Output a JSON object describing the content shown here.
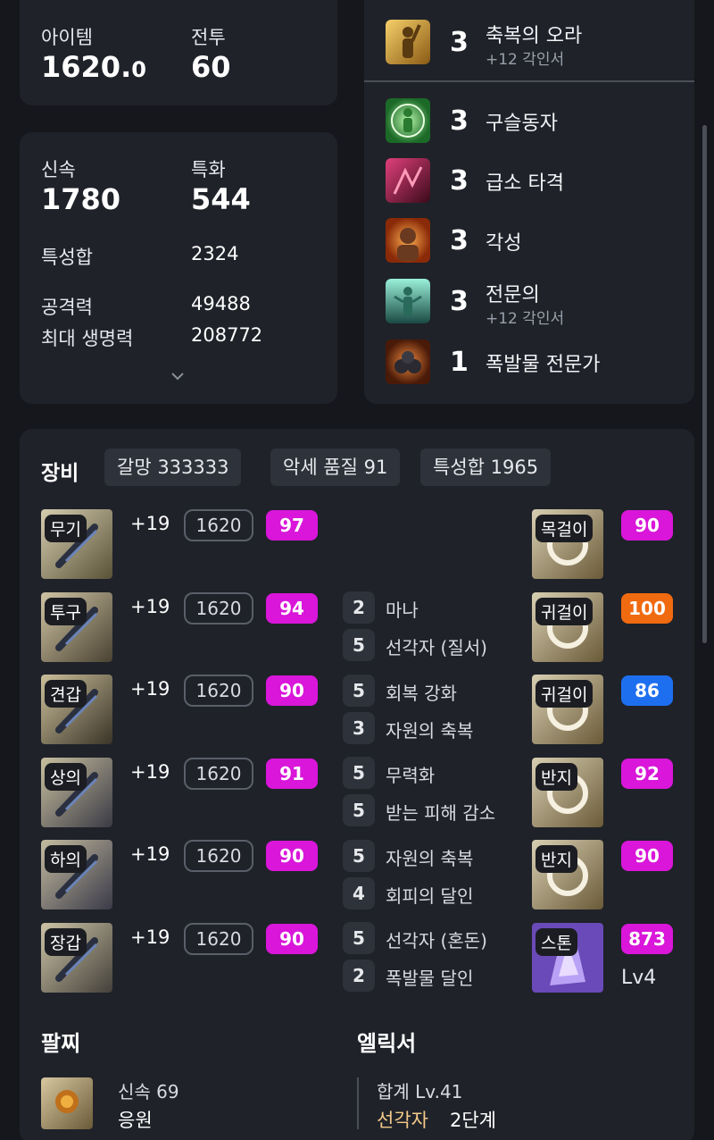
{
  "summary": {
    "item_level_label": "아이템",
    "item_level_int": "1620.",
    "item_level_dec": "0",
    "combat_label": "전투",
    "combat_value": "60"
  },
  "stats": {
    "swift_label": "신속",
    "swift_value": "1780",
    "spec_label": "특화",
    "spec_value": "544",
    "sum_label": "특성합",
    "sum_value": "2324",
    "atk_label": "공격력",
    "atk_value": "49488",
    "hp_label": "최대 생명력",
    "hp_value": "208772"
  },
  "engravings": [
    {
      "level": "3",
      "name": "축복의 오라",
      "sub": "+12 각인서"
    },
    {
      "level": "3",
      "name": "구슬동자",
      "sub": ""
    },
    {
      "level": "3",
      "name": "급소 타격",
      "sub": ""
    },
    {
      "level": "3",
      "name": "각성",
      "sub": ""
    },
    {
      "level": "3",
      "name": "전문의",
      "sub": "+12 각인서"
    },
    {
      "level": "1",
      "name": "폭발물 전문가",
      "sub": ""
    }
  ],
  "equipment": {
    "title": "장비",
    "chips": [
      "갈망 333333",
      "악세 품질 91",
      "특성합 1965"
    ],
    "armor": [
      {
        "slot": "무기",
        "hone": "+19",
        "ilvl": "1620",
        "quality": "97"
      },
      {
        "slot": "투구",
        "hone": "+19",
        "ilvl": "1620",
        "quality": "94"
      },
      {
        "slot": "견갑",
        "hone": "+19",
        "ilvl": "1620",
        "quality": "90"
      },
      {
        "slot": "상의",
        "hone": "+19",
        "ilvl": "1620",
        "quality": "91"
      },
      {
        "slot": "하의",
        "hone": "+19",
        "ilvl": "1620",
        "quality": "90"
      },
      {
        "slot": "장갑",
        "hone": "+19",
        "ilvl": "1620",
        "quality": "90"
      }
    ],
    "accessory_engr": [
      {
        "num": "2",
        "name": "마나"
      },
      {
        "num": "5",
        "name": "선각자 (질서)"
      },
      {
        "num": "5",
        "name": "회복 강화"
      },
      {
        "num": "3",
        "name": "자원의 축복"
      },
      {
        "num": "5",
        "name": "무력화"
      },
      {
        "num": "5",
        "name": "받는 피해 감소"
      },
      {
        "num": "5",
        "name": "자원의 축복"
      },
      {
        "num": "4",
        "name": "회피의 달인"
      },
      {
        "num": "5",
        "name": "선각자 (혼돈)"
      },
      {
        "num": "2",
        "name": "폭발물 달인"
      }
    ],
    "accessories": [
      {
        "slot": "목걸이",
        "quality": "90",
        "color": "#d916d9"
      },
      {
        "slot": "귀걸이",
        "quality": "100",
        "color": "#f06a10"
      },
      {
        "slot": "귀걸이",
        "quality": "86",
        "color": "#1e6ff0"
      },
      {
        "slot": "반지",
        "quality": "92",
        "color": "#d916d9"
      },
      {
        "slot": "반지",
        "quality": "90",
        "color": "#d916d9"
      },
      {
        "slot": "스톤",
        "quality": "873",
        "color": "#d916d9"
      }
    ],
    "stone_level": "Lv4"
  },
  "bracelet": {
    "title": "팔찌",
    "line1": "신속 69",
    "line2": "응원"
  },
  "elixir": {
    "title": "엘릭서",
    "total": "합계 Lv.41",
    "name": "선각자",
    "stage": "2단계",
    "name_color": "#f5c98a"
  },
  "icons": {
    "expand": "chevron-down-icon"
  }
}
